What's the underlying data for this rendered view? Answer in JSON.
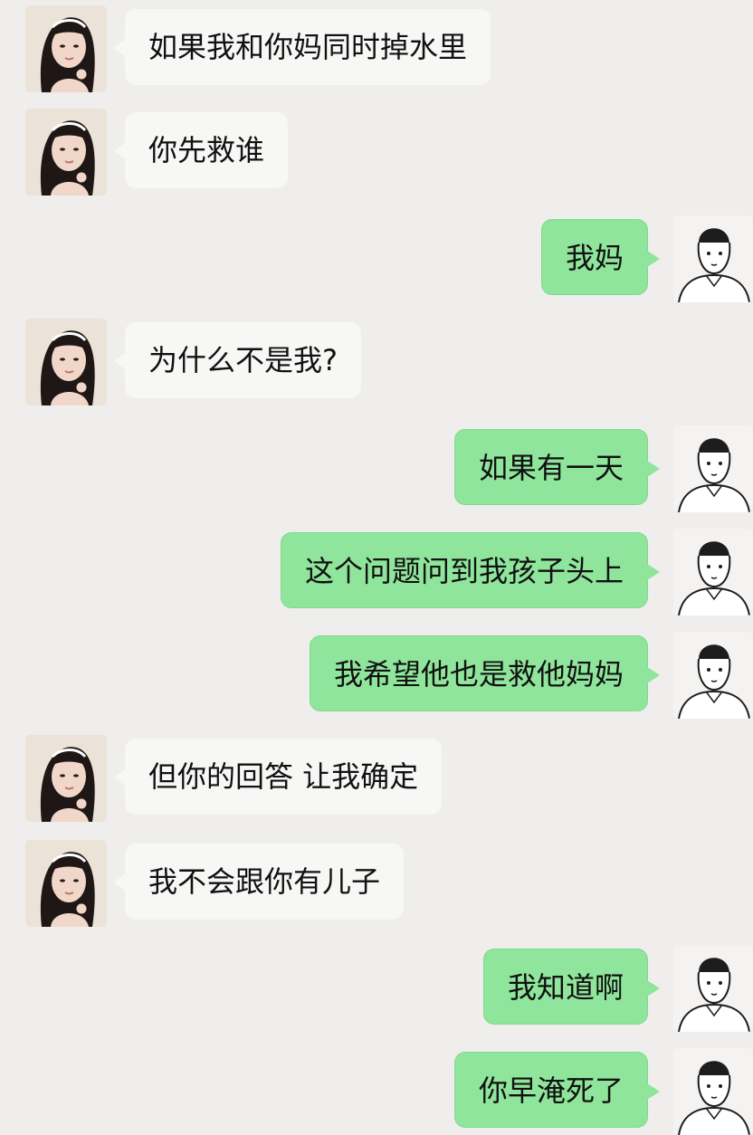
{
  "messages": [
    {
      "side": "left",
      "text": "如果我和你妈同时掉水里"
    },
    {
      "side": "left",
      "text": "你先救谁"
    },
    {
      "side": "right",
      "text": "我妈"
    },
    {
      "side": "left",
      "text": "为什么不是我?"
    },
    {
      "side": "right",
      "text": "如果有一天"
    },
    {
      "side": "right",
      "text": "这个问题问到我孩子头上"
    },
    {
      "side": "right",
      "text": "我希望他也是救他妈妈"
    },
    {
      "side": "left",
      "text": "但你的回答 让我确定"
    },
    {
      "side": "left",
      "text": "我不会跟你有儿子"
    },
    {
      "side": "right",
      "text": "我知道啊"
    },
    {
      "side": "right",
      "text": "你早淹死了"
    }
  ],
  "avatars": {
    "left": "girl-avatar-icon",
    "right": "boy-sketch-avatar-icon"
  },
  "colors": {
    "background": "#efeeec",
    "left_bubble": "#f7f7f6",
    "right_bubble": "#8fe59b"
  }
}
